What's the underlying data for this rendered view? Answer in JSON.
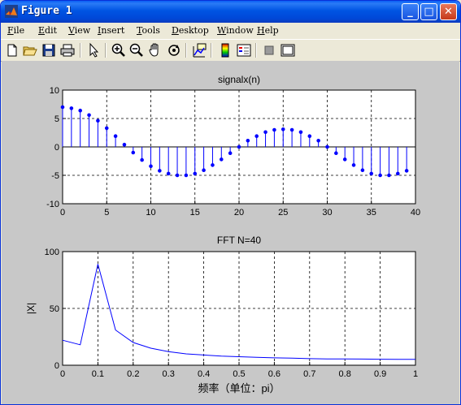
{
  "window": {
    "title": "Figure 1",
    "minimize": "_",
    "maximize": "□",
    "close": "✕"
  },
  "menubar": {
    "items": [
      "File",
      "Edit",
      "View",
      "Insert",
      "Tools",
      "Desktop",
      "Window",
      "Help"
    ],
    "dock_arrow": "↘"
  },
  "toolbar": {
    "tools": [
      "new-figure",
      "open-file",
      "save",
      "print",
      "edit-plot-arrow",
      "zoom-in",
      "zoom-out",
      "pan",
      "rotate-3d",
      "data-cursor",
      "colorbar",
      "legend",
      "hide-plot-tools",
      "show-plot-tools"
    ]
  },
  "colors": {
    "background": "#c8c8c8",
    "plot_line": "#0000ff",
    "axes_bg": "#ffffff",
    "title_bar": "#0054e3"
  },
  "chart_data": [
    {
      "type": "scatter",
      "style": "stem",
      "title": "signalx(n)",
      "xlabel": "",
      "ylabel": "",
      "xlim": [
        0,
        40
      ],
      "ylim": [
        -10,
        10
      ],
      "xticks": [
        "0",
        "5",
        "10",
        "15",
        "20",
        "25",
        "30",
        "35",
        "40"
      ],
      "yticks": [
        "10",
        "5",
        "0",
        "-5",
        "-10"
      ],
      "grid": "dashed",
      "x": [
        0,
        1,
        2,
        3,
        4,
        5,
        6,
        7,
        8,
        9,
        10,
        11,
        12,
        13,
        14,
        15,
        16,
        17,
        18,
        19,
        20,
        21,
        22,
        23,
        24,
        25,
        26,
        27,
        28,
        29,
        30,
        31,
        32,
        33,
        34,
        35,
        36,
        37,
        38,
        39
      ],
      "y": [
        7.0,
        6.8,
        6.4,
        5.6,
        4.6,
        3.3,
        1.9,
        0.4,
        -1.0,
        -2.3,
        -3.4,
        -4.2,
        -4.7,
        -5.0,
        -5.0,
        -4.7,
        -4.1,
        -3.2,
        -2.2,
        -1.1,
        0.0,
        1.1,
        1.9,
        2.6,
        3.0,
        3.1,
        3.0,
        2.6,
        1.9,
        1.1,
        0.0,
        -1.1,
        -2.2,
        -3.2,
        -4.1,
        -4.7,
        -5.0,
        -5.0,
        -4.7,
        -4.2
      ]
    },
    {
      "type": "line",
      "title": "FFT N=40",
      "xlabel": "频率（单位：pi）",
      "ylabel": "|X|",
      "xlim": [
        0,
        1
      ],
      "ylim": [
        0,
        100
      ],
      "xticks": [
        "0",
        "0.1",
        "0.2",
        "0.3",
        "0.4",
        "0.5",
        "0.6",
        "0.7",
        "0.8",
        "0.9",
        "1"
      ],
      "yticks": [
        "100",
        "50",
        "0"
      ],
      "grid": "dashed",
      "x": [
        0,
        0.05,
        0.1,
        0.15,
        0.2,
        0.25,
        0.3,
        0.35,
        0.4,
        0.45,
        0.5,
        0.55,
        0.6,
        0.65,
        0.7,
        0.75,
        0.8,
        0.85,
        0.9,
        0.95,
        1.0
      ],
      "y": [
        22,
        18,
        89,
        31,
        20,
        15,
        12,
        10,
        9,
        8,
        7.5,
        7,
        6.5,
        6.2,
        5.8,
        5.6,
        5.5,
        5.4,
        5.3,
        5.2,
        5.2
      ]
    }
  ]
}
